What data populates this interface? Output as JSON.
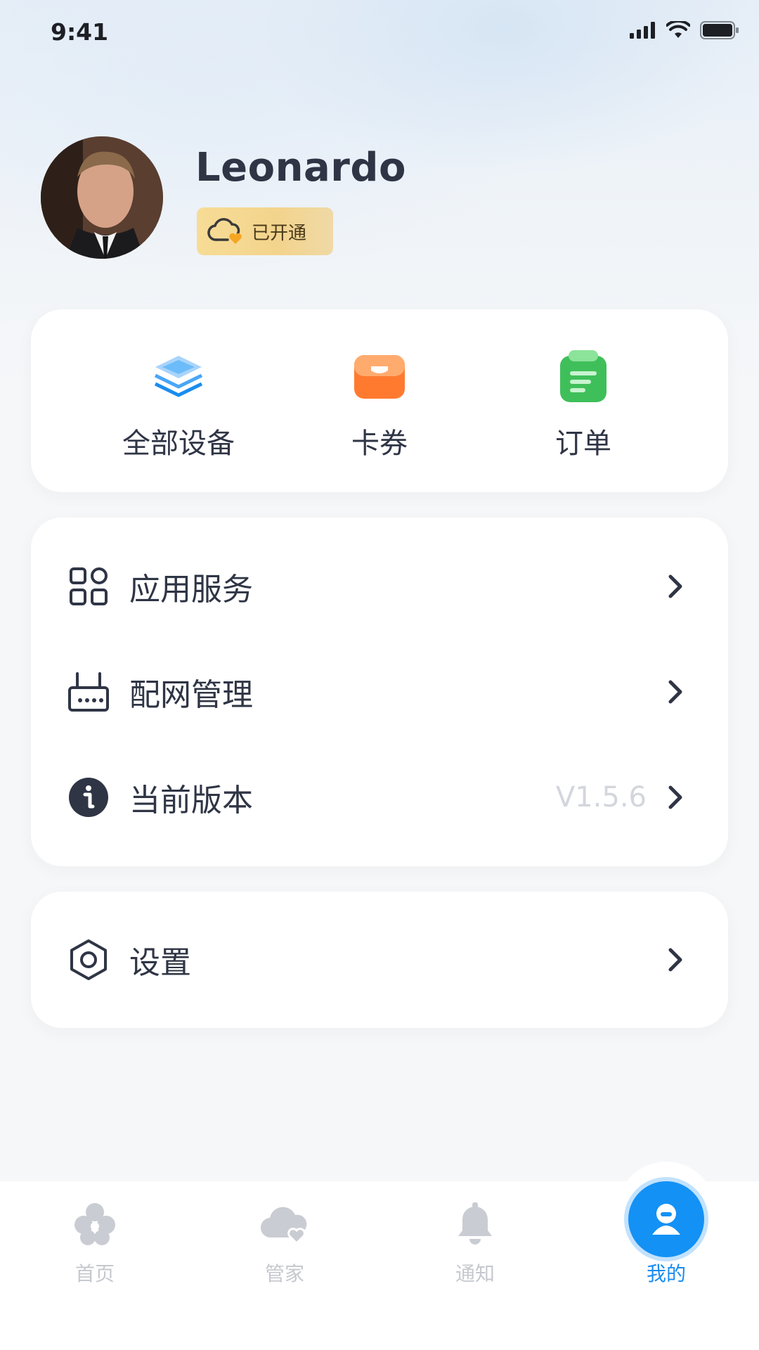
{
  "status_bar": {
    "time": "9:41"
  },
  "profile": {
    "name": "Leonardo",
    "membership_label": "已开通"
  },
  "quick_actions": [
    {
      "label": "全部设备",
      "icon": "layers-icon"
    },
    {
      "label": "卡券",
      "icon": "coupon-wallet-icon"
    },
    {
      "label": "订单",
      "icon": "order-clipboard-icon"
    }
  ],
  "menu": {
    "items": [
      {
        "label": "应用服务",
        "icon": "grid-apps-icon",
        "value": ""
      },
      {
        "label": "配网管理",
        "icon": "router-icon",
        "value": ""
      },
      {
        "label": "当前版本",
        "icon": "info-icon",
        "value": "V1.5.6"
      }
    ]
  },
  "settings": {
    "label": "设置",
    "icon": "hexagon-settings-icon"
  },
  "tabbar": {
    "tabs": [
      {
        "label": "首页",
        "icon": "clover-home-icon",
        "active": false
      },
      {
        "label": "管家",
        "icon": "cloud-heart-icon",
        "active": false
      },
      {
        "label": "通知",
        "icon": "bell-icon",
        "active": false
      },
      {
        "label": "我的",
        "icon": "user-icon",
        "active": true
      }
    ]
  },
  "colors": {
    "accent": "#1391f5",
    "text_primary": "#2f3545",
    "text_muted": "#c5c8ce",
    "badge_gold": "#f3d48d"
  }
}
